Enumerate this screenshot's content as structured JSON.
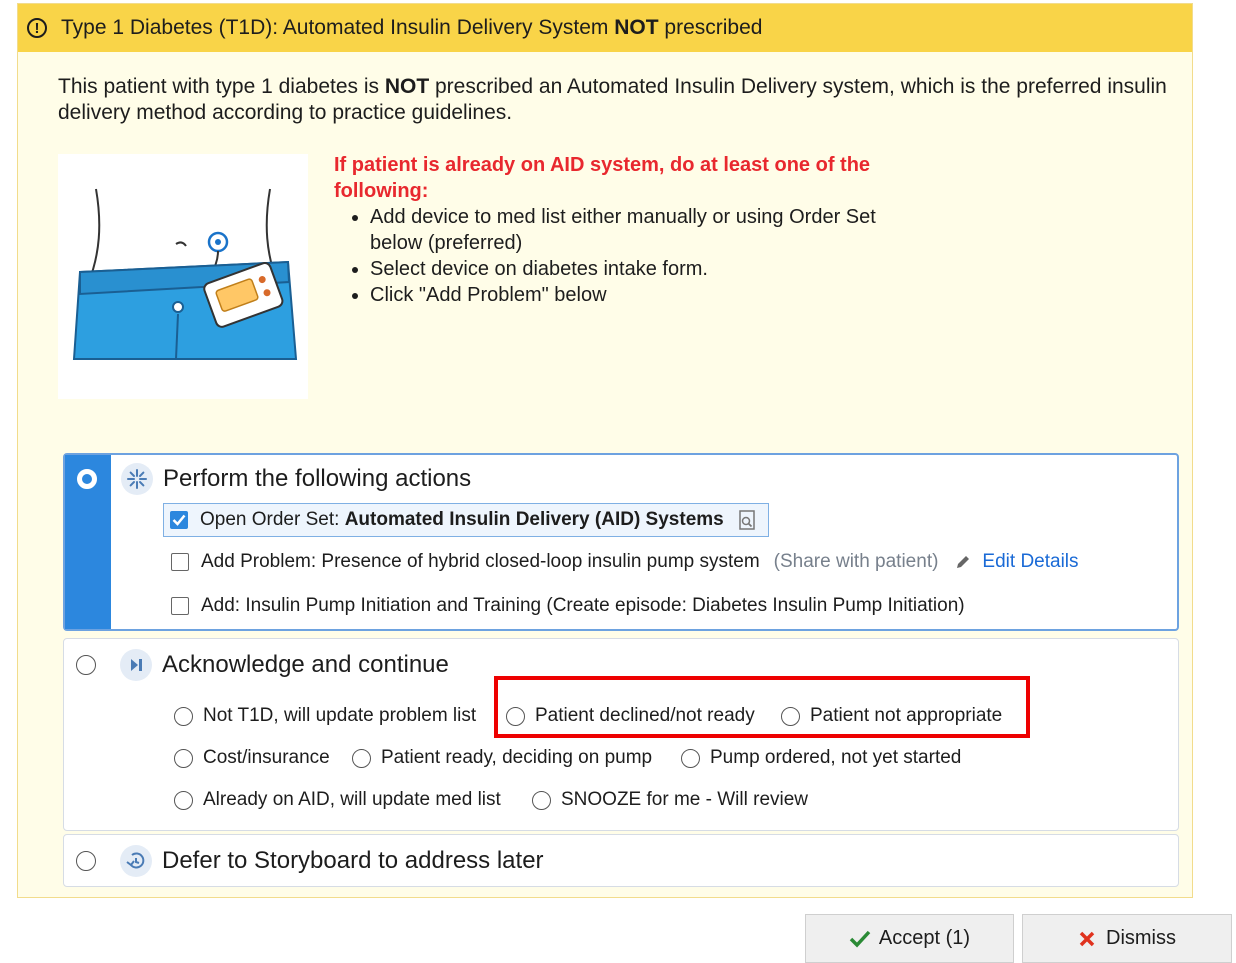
{
  "alert": {
    "title_prefix": "Type 1 Diabetes (T1D): Automated Insulin Delivery System ",
    "title_bold": "NOT",
    "title_suffix": " prescribed",
    "intro_prefix": "This patient with type 1 diabetes is ",
    "intro_bold": "NOT",
    "intro_suffix": " prescribed an Automated Insulin Delivery system, which is the preferred insulin delivery method according to practice guidelines.",
    "instructions_heading": "If patient is already on AID system, do at least one of the following:",
    "instructions": [
      "Add device to med list either manually or using Order Set below (preferred)",
      "Select device on diabetes intake form.",
      "Click \"Add Problem\" below"
    ]
  },
  "perform": {
    "title": "Perform the following actions",
    "order_set_prefix": "Open Order Set: ",
    "order_set_name": "Automated Insulin Delivery (AID) Systems",
    "add_problem_text": "Add Problem: Presence of hybrid closed-loop insulin pump system",
    "share_text": "(Share with patient)",
    "edit_details": "Edit Details",
    "add_training_text": "Add: Insulin Pump Initiation and Training (Create episode: Diabetes Insulin Pump Initiation)"
  },
  "acknowledge": {
    "title": "Acknowledge and continue",
    "reasons": [
      "Not T1D, will update problem list",
      "Patient declined/not ready",
      "Patient not appropriate",
      "Cost/insurance",
      "Patient ready, deciding on pump",
      "Pump ordered, not yet started",
      "Already on AID, will update med list",
      "SNOOZE for me - Will review"
    ]
  },
  "defer": {
    "title": "Defer to Storyboard to address later"
  },
  "buttons": {
    "accept": "Accept (1)",
    "dismiss": "Dismiss"
  },
  "colors": {
    "header": "#f9d448",
    "accent": "#2c87de",
    "alert_red": "#e8282e",
    "highlight": "#ee0000"
  }
}
